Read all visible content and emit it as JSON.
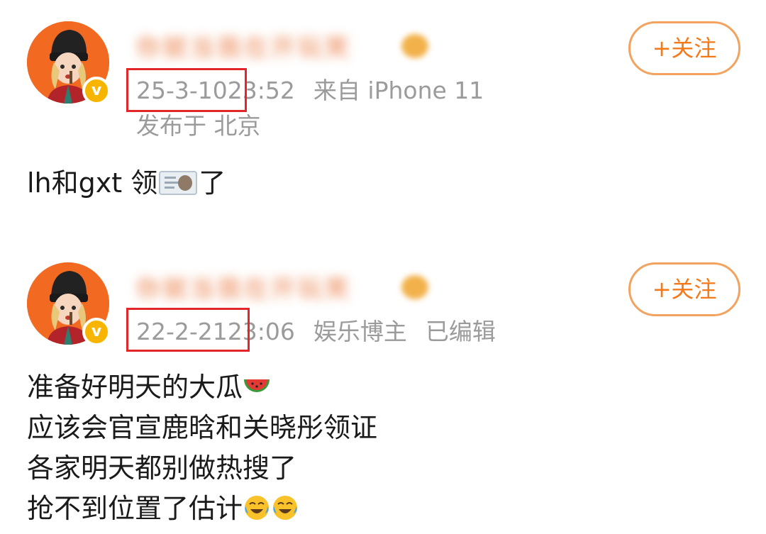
{
  "posts": [
    {
      "username": "你就当我在开玩笑",
      "date": "25-3-10",
      "time": "23:52",
      "source": "来自 iPhone 11",
      "location": "发布于 北京",
      "follow_label": "+关注",
      "content": {
        "before_icon": "lh和gxt 领",
        "icon": "id-card-icon",
        "after_icon": "了"
      }
    },
    {
      "username": "你就当我在开玩笑",
      "date": "22-2-21",
      "time": "23:06",
      "category": "娱乐博主",
      "edited": "已编辑",
      "follow_label": "+关注",
      "content": {
        "lines": [
          {
            "text": "准备好明天的大瓜",
            "icon": "watermelon-icon"
          },
          {
            "text": "应该会官宣鹿晗和关晓彤领证"
          },
          {
            "text": "各家明天都别做热搜了"
          },
          {
            "text": "抢不到位置了估计",
            "icon": "crying-laughing-icon"
          }
        ]
      }
    }
  ],
  "colors": {
    "highlight_box": "#e2262a",
    "follow_accent": "#f27a1a",
    "meta_text": "#9b9b9b",
    "verified_badge": "#f7b500"
  }
}
